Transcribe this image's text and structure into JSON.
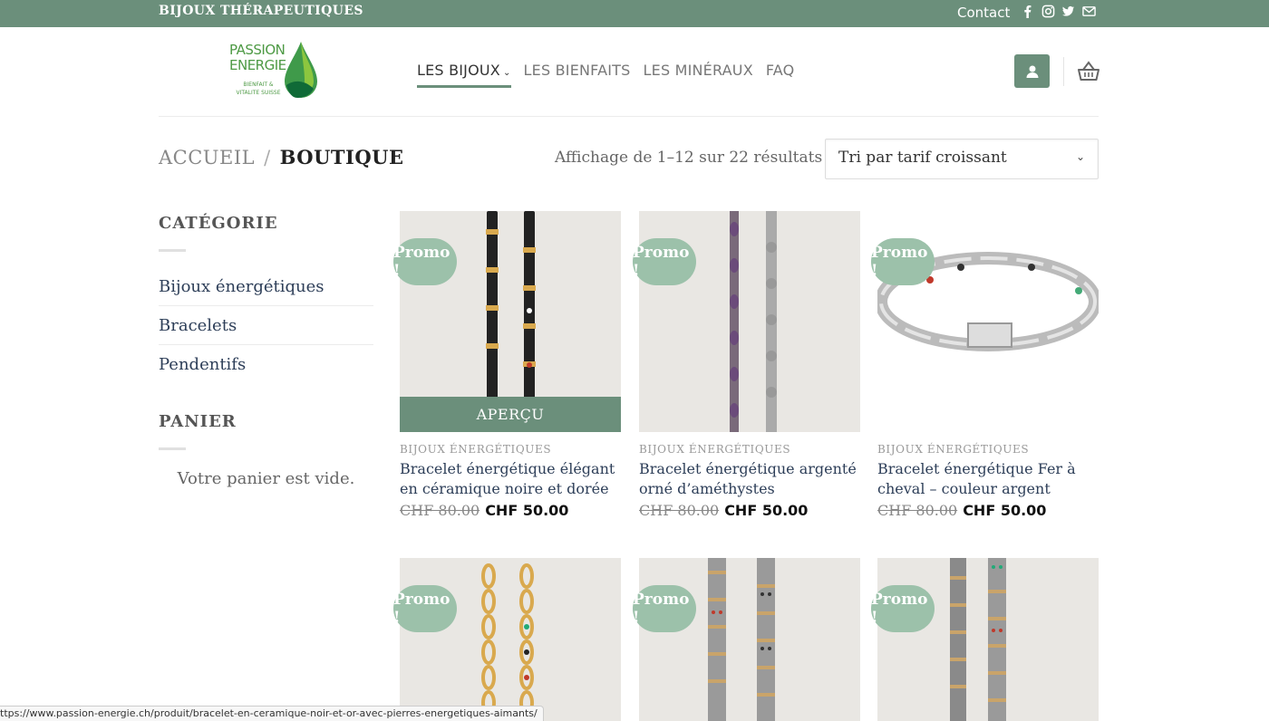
{
  "topbar": {
    "brand": "BIJOUX THÉRAPEUTIQUES",
    "contact": "Contact",
    "social_icons": [
      "facebook-icon",
      "instagram-icon",
      "twitter-icon",
      "mail-icon"
    ]
  },
  "logo": {
    "line1": "PASSION",
    "line2": "ENERGIE",
    "tagline": "BIENFAIT & VITALITE SUISSE"
  },
  "nav": {
    "items": [
      {
        "label": "LES BIJOUX",
        "active": true,
        "has_dropdown": true
      },
      {
        "label": "LES BIENFAITS",
        "active": false
      },
      {
        "label": "LES MINÉRAUX",
        "active": false
      },
      {
        "label": "FAQ",
        "active": false
      }
    ]
  },
  "breadcrumb": {
    "home": "ACCUEIL",
    "separator": "/",
    "current": "BOUTIQUE"
  },
  "results_text": "Affichage de 1–12 sur 22 résultats",
  "sort": {
    "selected": "Tri par tarif croissant"
  },
  "sidebar": {
    "category_title": "CATÉGORIE",
    "categories": [
      "Bijoux énergétiques",
      "Bracelets",
      "Pendentifs"
    ],
    "cart_title": "PANIER",
    "cart_empty": "Votre panier est vide."
  },
  "products": [
    {
      "badge": "Promo !",
      "category": "BIJOUX ÉNERGÉTIQUES",
      "title": "Bracelet énergétique élégant en céramique noire et dorée",
      "old_price": "CHF 80.00",
      "price": "CHF 50.00",
      "quick_view": "APERÇU"
    },
    {
      "badge": "Promo !",
      "category": "BIJOUX ÉNERGÉTIQUES",
      "title": "Bracelet énergétique argenté orné d’améthystes",
      "old_price": "CHF 80.00",
      "price": "CHF 50.00"
    },
    {
      "badge": "Promo !",
      "category": "BIJOUX ÉNERGÉTIQUES",
      "title": "Bracelet énergétique Fer à cheval – couleur argent",
      "old_price": "CHF 80.00",
      "price": "CHF 50.00"
    },
    {
      "badge": "Promo !"
    },
    {
      "badge": "Promo !"
    },
    {
      "badge": "Promo !"
    }
  ],
  "status_url": "ttps://www.passion-energie.ch/produit/bracelet-en-ceramique-noir-et-or-avec-pierres-energetiques-aimants/",
  "colors": {
    "accent": "#6b8f7b",
    "promo": "#9cc1aa",
    "link": "#2d3e58",
    "logo_green": "#4e9a45"
  }
}
